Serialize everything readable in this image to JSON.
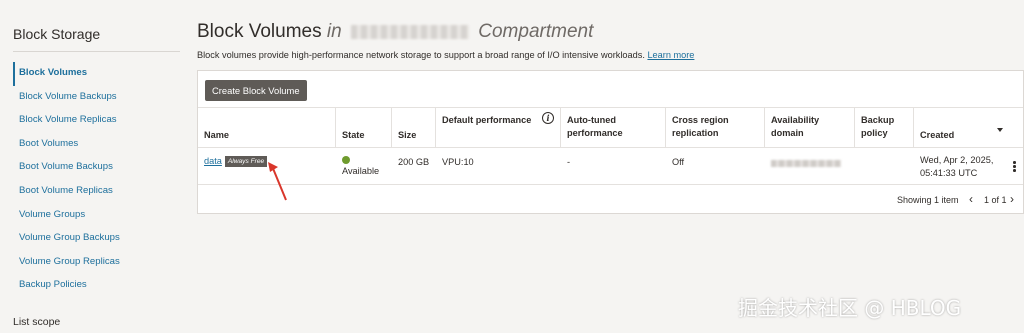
{
  "sidebar": {
    "title": "Block Storage",
    "items": [
      {
        "label": "Block Volumes",
        "active": true
      },
      {
        "label": "Block Volume Backups"
      },
      {
        "label": "Block Volume Replicas"
      },
      {
        "label": "Boot Volumes"
      },
      {
        "label": "Boot Volume Backups"
      },
      {
        "label": "Boot Volume Replicas"
      },
      {
        "label": "Volume Groups"
      },
      {
        "label": "Volume Group Backups"
      },
      {
        "label": "Volume Group Replicas"
      },
      {
        "label": "Backup Policies"
      }
    ],
    "list_scope": "List scope"
  },
  "header": {
    "title": "Block Volumes",
    "title_in": "in",
    "title_suffix": "Compartment",
    "description": "Block volumes provide high-performance network storage to support a broad range of I/O intensive workloads.",
    "learn_more": "Learn more"
  },
  "toolbar": {
    "create_label": "Create Block Volume"
  },
  "table": {
    "headers": {
      "name": "Name",
      "state": "State",
      "size": "Size",
      "default_performance": "Default performance",
      "auto_tuned": "Auto-tuned performance",
      "cross_region": "Cross region replication",
      "availability_domain": "Availability domain",
      "backup_policy": "Backup policy",
      "created": "Created"
    },
    "rows": [
      {
        "name": "data",
        "badge": "Always Free",
        "state": "Available",
        "size": "200 GB",
        "default_performance": "VPU:10",
        "auto_tuned": "-",
        "cross_region": "Off",
        "backup_policy": "",
        "created_line1": "Wed, Apr 2, 2025,",
        "created_line2": "05:41:33 UTC"
      }
    ],
    "footer": {
      "showing": "Showing 1 item",
      "page": "1 of 1"
    }
  },
  "colors": {
    "accent": "#1d6f9c",
    "available": "#6f9b2e",
    "button": "#5f5b57",
    "annotation_arrow": "#d9362b"
  },
  "watermark": "掘金技术社区 @ HBLOG"
}
